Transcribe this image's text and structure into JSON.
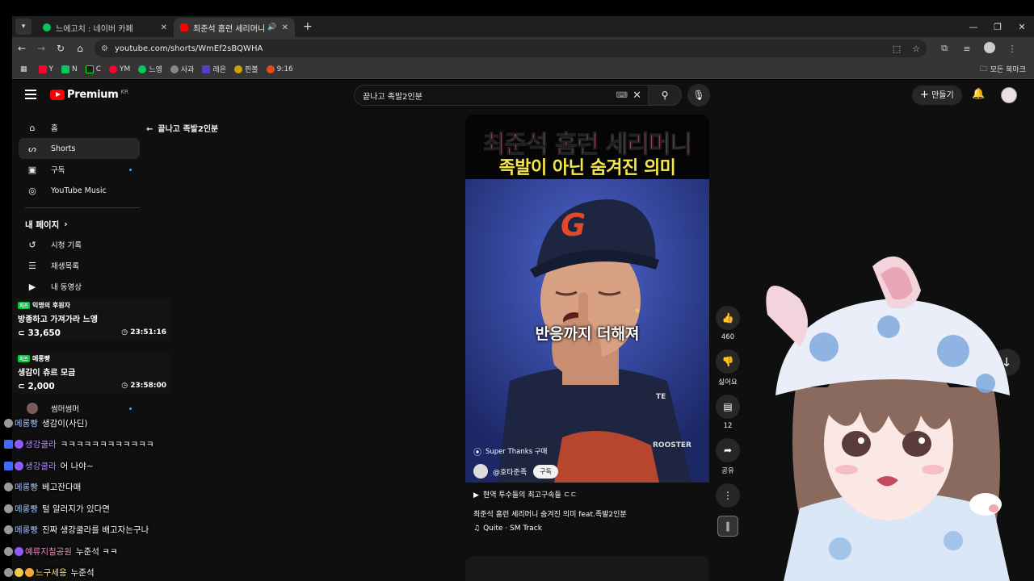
{
  "browser": {
    "tabs": [
      {
        "title": "느에고치 : 네이버 카페",
        "fav_color": "#03c75a"
      },
      {
        "title": "최준석 홈런 세리머니 숨겨진",
        "fav_color": "#ff0000"
      }
    ],
    "url": "youtube.com/shorts/WmEf2sBQWHA",
    "bookmarks": [
      {
        "label": "Y",
        "color": "#ff0033"
      },
      {
        "label": "N",
        "color": "#03c75a"
      },
      {
        "label": "C",
        "color": "#1a1a1a"
      },
      {
        "label": "YM",
        "color": "#ff0033"
      },
      {
        "label": "느엥",
        "color": "#03c75a"
      },
      {
        "label": "사과",
        "color": "#888"
      },
      {
        "label": "레온",
        "color": "#5b3cc4"
      },
      {
        "label": "핀볼",
        "color": "#c9a400"
      },
      {
        "label": "9:16",
        "color": "#e64a19"
      }
    ],
    "all_bookmarks": "모든 북마크"
  },
  "yt": {
    "logo": "Premium",
    "region": "KR",
    "search_query": "끝나고 족발2인분",
    "create_label": "만들기",
    "back_query": "끝나고 족발2인분",
    "sidebar": {
      "main": [
        {
          "label": "홈",
          "icon": "home-icon"
        },
        {
          "label": "Shorts",
          "icon": "shorts-icon"
        },
        {
          "label": "구독",
          "icon": "subscriptions-icon"
        },
        {
          "label": "YouTube Music",
          "icon": "music-icon"
        }
      ],
      "you_header": "내 페이지",
      "you": [
        {
          "label": "시청 기록"
        },
        {
          "label": "재생목록"
        },
        {
          "label": "내 동영상"
        }
      ],
      "sub": [
        {
          "label": "썸머썸머"
        }
      ]
    },
    "short": {
      "title_line1": "최준석 홈런 세리머니",
      "title_line2": "족발이 아닌 숨겨진 의미",
      "caption": "반응까지 더해져",
      "super_thanks": "Super Thanks 구매",
      "channel": "@호타준족",
      "subscribe": "구독",
      "related": "현역 투수들의 최고구속들 ㄷㄷ",
      "description": "최준석 홈런 세리머니 숨겨진 의미 feat.족발2인분",
      "music": "Quite · SM Track"
    },
    "actions": {
      "likes": "460",
      "dislike": "싫어요",
      "comments": "12",
      "share": "공유"
    }
  },
  "overlay": {
    "cards": [
      {
        "tag": "익명의 후원자",
        "message": "방종하고 가져가라 느엥",
        "amount": "33,650",
        "time": "23:51:16"
      },
      {
        "tag": "메롱빵",
        "message": "생감이 츄르 모금",
        "amount": "2,000",
        "time": "23:58:00"
      }
    ],
    "chat": [
      {
        "nick": "메롱빵",
        "text": "생감이(사딘)",
        "nick_color": "#a8c8ff"
      },
      {
        "nick": "생강쿨라",
        "text": "ㅋㅋㅋㅋㅋㅋㅋㅋㅋㅋㅋㅋ",
        "nick_color": "#b98cff"
      },
      {
        "nick": "생강쿨라",
        "text": "어 나야~",
        "nick_color": "#b98cff"
      },
      {
        "nick": "메롱빵",
        "text": "베고잔다매",
        "nick_color": "#a8c8ff"
      },
      {
        "nick": "메롱빵",
        "text": "털 알러지가 있다면",
        "nick_color": "#a8c8ff"
      },
      {
        "nick": "메롱빵",
        "text": "진짜 생강쿨라를 배고자는구나",
        "nick_color": "#a8c8ff"
      },
      {
        "nick": "예류지칠공원",
        "text": "누준석 ㅋㅋ",
        "nick_color": "#ff8fc8"
      },
      {
        "nick": "느구세응",
        "text": "누준석",
        "nick_color": "#ffe566"
      }
    ]
  }
}
